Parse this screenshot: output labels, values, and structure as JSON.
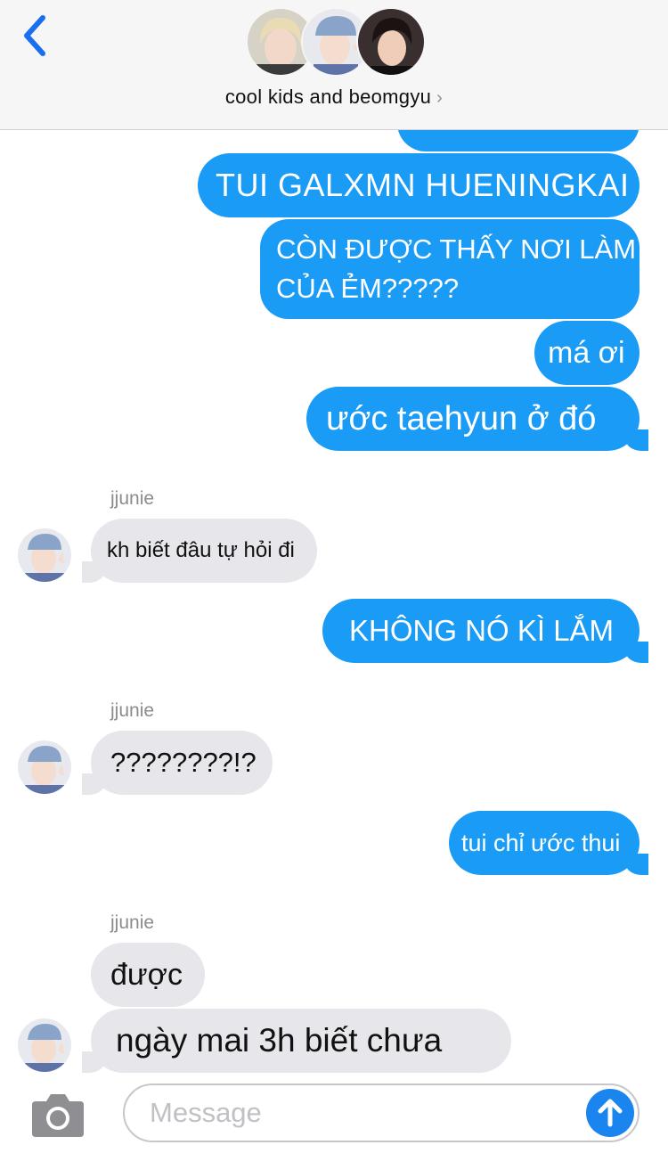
{
  "header": {
    "group_name": "cool kids and beomgyu",
    "chevron": "›",
    "back_icon": "chevron-left-icon",
    "avatars": [
      "avatar-blonde",
      "avatar-blue-hat",
      "avatar-dark-hair"
    ]
  },
  "messages": [
    {
      "id": "m0",
      "dir": "out",
      "text": ""
    },
    {
      "id": "m1",
      "dir": "out",
      "text": "TUI GALXMN HUENINGKAI"
    },
    {
      "id": "m2",
      "dir": "out",
      "line1": "CÒN ĐƯỢC THẤY NƠI LÀM VIỆC",
      "line2": "CỦA ẺM?????"
    },
    {
      "id": "m3",
      "dir": "out",
      "text": "má ơi"
    },
    {
      "id": "m4",
      "dir": "out",
      "text": "ước taehyun ở đó"
    },
    {
      "id": "m5",
      "dir": "in",
      "sender": "jjunie",
      "text": "kh biết đâu tự hỏi đi"
    },
    {
      "id": "m6",
      "dir": "out",
      "text": "KHÔNG NÓ KÌ LẮM"
    },
    {
      "id": "m7",
      "dir": "in",
      "sender": "jjunie",
      "text": "????????!?"
    },
    {
      "id": "m8",
      "dir": "out",
      "text": "tui chỉ ước thui"
    },
    {
      "id": "m9",
      "dir": "in",
      "sender": "jjunie",
      "text": "được"
    },
    {
      "id": "m10",
      "dir": "in",
      "text": "ngày mai 3h biết chưa"
    }
  ],
  "composer": {
    "placeholder": "Message",
    "camera_icon": "camera-icon",
    "send_icon": "arrow-up-icon"
  },
  "colors": {
    "outgoing_bubble": "#1a9bf5",
    "incoming_bubble": "#e6e6eb",
    "accent": "#1a84ef",
    "header_bg": "#f6f6f7"
  }
}
